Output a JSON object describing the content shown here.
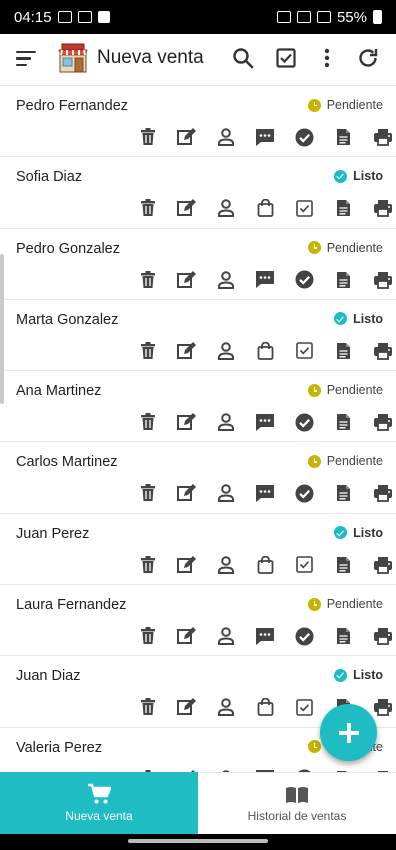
{
  "status_bar": {
    "time": "04:15",
    "battery": "55%"
  },
  "toolbar": {
    "title": "Nueva venta",
    "icons": [
      "menu-icon",
      "store-icon",
      "search-icon",
      "checkbox-icon",
      "more-vert-icon",
      "refresh-icon"
    ]
  },
  "orders": [
    {
      "name": "Pedro Fernandez",
      "status": "Pendiente",
      "state": "pending"
    },
    {
      "name": "Sofia Diaz",
      "status": "Listo",
      "state": "ready"
    },
    {
      "name": "Pedro Gonzalez",
      "status": "Pendiente",
      "state": "pending"
    },
    {
      "name": "Marta Gonzalez",
      "status": "Listo",
      "state": "ready"
    },
    {
      "name": "Ana Martinez",
      "status": "Pendiente",
      "state": "pending"
    },
    {
      "name": "Carlos Martinez",
      "status": "Pendiente",
      "state": "pending"
    },
    {
      "name": "Juan Perez",
      "status": "Listo",
      "state": "ready"
    },
    {
      "name": "Laura Fernandez",
      "status": "Pendiente",
      "state": "pending"
    },
    {
      "name": "Juan Diaz",
      "status": "Listo",
      "state": "ready"
    },
    {
      "name": "Valeria Perez",
      "status": "Pendiente",
      "state": "pending"
    }
  ],
  "action_icons": {
    "pending": [
      "trash-icon",
      "edit-icon",
      "person-icon",
      "comment-icon",
      "check-circle-icon",
      "document-icon",
      "print-icon"
    ],
    "ready": [
      "trash-icon",
      "edit-icon",
      "person-icon",
      "bag-icon",
      "checkbox-icon",
      "document-icon",
      "print-icon"
    ]
  },
  "bottom_nav": {
    "new_sale": "Nueva venta",
    "history": "Historial de ventas"
  },
  "colors": {
    "accent": "#1fbcc4",
    "pending": "#c8b400",
    "icon": "#444444"
  }
}
